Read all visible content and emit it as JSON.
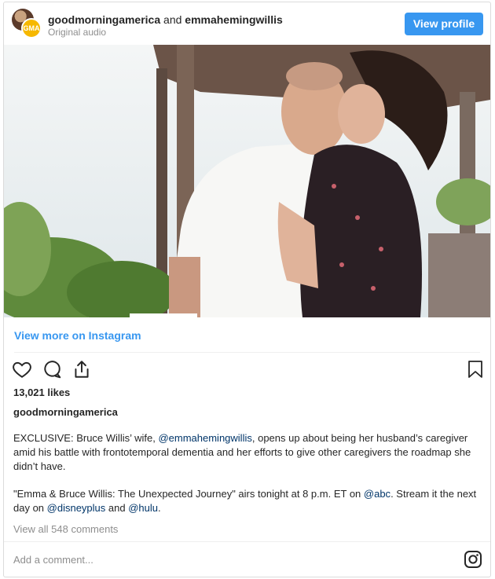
{
  "header": {
    "account_primary": "goodmorningamerica",
    "connector": "and",
    "account_secondary": "emmahemingwillis",
    "audio_label": "Original audio",
    "view_profile_label": "View profile",
    "avatar_badge": "GMA"
  },
  "photo": {
    "description_icon": "photo-placeholder"
  },
  "view_more_label": "View more on Instagram",
  "icons": {
    "like": "heart-icon",
    "comment": "comment-icon",
    "share": "share-icon",
    "save": "bookmark-icon",
    "logo": "instagram-icon"
  },
  "likes_label": "13,021 likes",
  "poster_username": "goodmorningamerica",
  "caption": {
    "p1_before": "EXCLUSIVE: Bruce Willis’ wife, ",
    "p1_mention": "@emmahemingwillis",
    "p1_after": ", opens up about being her husband’s caregiver amid his battle with frontotemporal dementia and her efforts to give other caregivers the roadmap she didn’t have.",
    "p2_before": "\"Emma & Bruce Willis: The Unexpected Journey\" airs tonight at 8 p.m. ET on ",
    "p2_mention1": "@abc",
    "p2_mid": ". Stream it the next day on ",
    "p2_mention2": "@disneyplus",
    "p2_and": " and ",
    "p2_mention3": "@hulu",
    "p2_end": "."
  },
  "comments_link": "View all 548 comments",
  "comment_placeholder": "Add a comment...",
  "colors": {
    "accent": "#3897f0",
    "text": "#262626",
    "muted": "#8e8e8e",
    "border": "#dbdbdb",
    "gma_yellow": "#f6b800"
  }
}
